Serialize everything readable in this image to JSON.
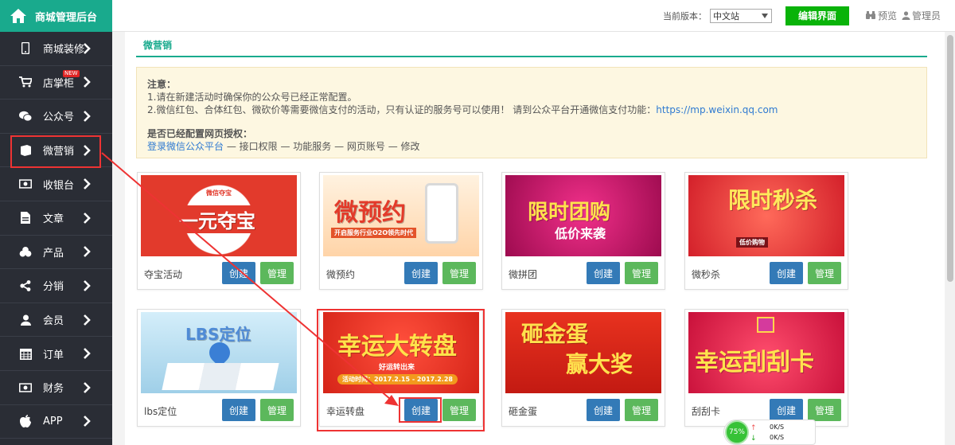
{
  "brand": {
    "title": "商城管理后台"
  },
  "sidebar": {
    "items": [
      {
        "label": "商城装修",
        "icon": "mobile-icon"
      },
      {
        "label": "店掌柜",
        "icon": "cart-icon",
        "badge": "NEW"
      },
      {
        "label": "公众号",
        "icon": "wechat-icon"
      },
      {
        "label": "微营销",
        "icon": "book-icon"
      },
      {
        "label": "收银台",
        "icon": "cash-icon"
      },
      {
        "label": "文章",
        "icon": "document-icon"
      },
      {
        "label": "产品",
        "icon": "cubes-icon"
      },
      {
        "label": "分销",
        "icon": "share-icon"
      },
      {
        "label": "会员",
        "icon": "user-icon"
      },
      {
        "label": "订单",
        "icon": "calendar-icon"
      },
      {
        "label": "财务",
        "icon": "money-icon"
      },
      {
        "label": "APP",
        "icon": "apple-icon"
      }
    ]
  },
  "topbar": {
    "version_label": "当前版本：",
    "version_value": "中文站",
    "edit_button": "编辑界面",
    "preview": "预览",
    "admin": "管理员"
  },
  "page": {
    "tab": "微营销",
    "notice": {
      "title": "注意：",
      "line1": "1.请在新建活动时确保你的公众号已经正常配置。",
      "line2_text": "2.微信红包、合体红包、微砍价等需要微信支付的活动，只有认证的服务号可以使用！ 请到公众平台开通微信支付功能：",
      "line2_link": "https://mp.weixin.qq.com",
      "auth_title": "是否已经配置网页授权：",
      "auth_link": "登录微信公众平台",
      "auth_path": " — 接口权限 — 功能服务 — 网页账号 — 修改"
    }
  },
  "buttons": {
    "create": "创建",
    "manage": "管理"
  },
  "cards": [
    {
      "name": "夺宝活动",
      "banner_text": "一元夺宝",
      "banner_sub": "微信夺宝"
    },
    {
      "name": "微预约",
      "banner_text": "微预约",
      "banner_sub": "开启服务行业O2O领先时代"
    },
    {
      "name": "微拼团",
      "banner_text": "限时团购",
      "banner_sub": "低价来袭"
    },
    {
      "name": "微秒杀",
      "banner_text": "限时秒杀",
      "banner_sub": "低价购物"
    },
    {
      "name": "lbs定位",
      "banner_text": "LBS定位",
      "banner_sub": ""
    },
    {
      "name": "幸运转盘",
      "banner_text": "幸运大转盘",
      "banner_sub": "好运转出来",
      "banner_date": "活动时间：2017.2.15 - 2017.2.28"
    },
    {
      "name": "砸金蛋",
      "banner_text": "砸金蛋",
      "banner_sub": "赢大奖"
    },
    {
      "name": "刮刮卡",
      "banner_text": "幸运刮刮卡",
      "banner_sub": ""
    }
  ],
  "speed": {
    "percent": "75%",
    "up": "0K/S",
    "down": "0K/S"
  },
  "colors": {
    "accent": "#19aa8d",
    "sidebar": "#2a2d35",
    "create": "#337ab7",
    "manage": "#5cb85c",
    "annotation": "#e33333"
  }
}
